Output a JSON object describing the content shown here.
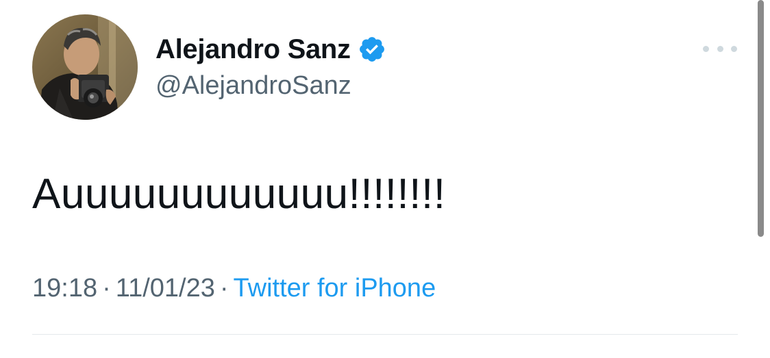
{
  "author": {
    "display_name": "Alejandro Sanz",
    "handle": "@AlejandroSanz",
    "verified": true
  },
  "tweet": {
    "text": "Auuuuuuuuuuuu!!!!!!!!",
    "time": "19:18",
    "date": "11/01/23",
    "separator": "·",
    "source": "Twitter for iPhone"
  },
  "colors": {
    "text": "#0f1419",
    "secondary": "#536471",
    "link": "#1d9bf0",
    "verified": "#1d9bf0",
    "divider": "#e4e8eb"
  },
  "icons": {
    "verified": "verified-badge-icon",
    "more": "more-options-icon"
  }
}
